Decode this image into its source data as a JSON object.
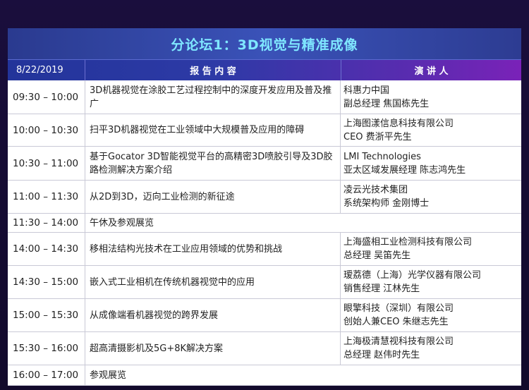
{
  "title": "分论坛1：3D视觉与精准成像",
  "header": {
    "date": "8/22/2019",
    "content": "报 告 内 容",
    "speaker": "演 讲 人"
  },
  "rows": [
    {
      "time": "09:30 – 10:00",
      "topic": "3D机器视觉在涂胶工艺过程控制中的深度开发应用及普及推广",
      "org": "科惠力中国",
      "person": "副总经理 焦国栋先生"
    },
    {
      "time": "10:00 – 10:30",
      "topic": "扫平3D机器视觉在工业领域中大规模普及应用的障碍",
      "org": "上海图漾信息科技有限公司",
      "person": "CEO 费浙平先生"
    },
    {
      "time": "10:30 – 11:00",
      "topic": "基于Gocator 3D智能视觉平台的高精密3D喷胶引导及3D胶路检测解决方案介绍",
      "org": "LMI Technologies",
      "person": "亚太区域发展经理 陈志鸿先生"
    },
    {
      "time": "11:00 – 11:30",
      "topic": "从2D到3D，迈向工业检测的新征途",
      "org": "凌云光技术集团",
      "person": "系统架构师 金刚博士"
    },
    {
      "time": "11:30 – 14:00",
      "topic": "午休及参观展览"
    },
    {
      "time": "14:00 – 14:30",
      "topic": "移相法结构光技术在工业应用领域的优势和挑战",
      "org": "上海盛相工业检测科技有限公司",
      "person": "总经理 吴笛先生"
    },
    {
      "time": "14:30 – 15:00",
      "topic": "嵌入式工业相机在传统机器视觉中的应用",
      "org": "瑷荔德（上海）光学仪器有限公司",
      "person": "销售经理 江林先生"
    },
    {
      "time": "15:00 – 15:30",
      "topic": "从成像端看机器视觉的跨界发展",
      "org": "眼擎科技（深圳）有限公司",
      "person": "创始人兼CEO 朱继志先生"
    },
    {
      "time": "15:30 – 16:00",
      "topic": "超高清摄影机及5G+8K解决方案",
      "org": "上海极清慧视科技有限公司",
      "person": "总经理 赵伟时先生"
    },
    {
      "time": "16:00 – 17:00",
      "topic": "参观展览"
    }
  ]
}
